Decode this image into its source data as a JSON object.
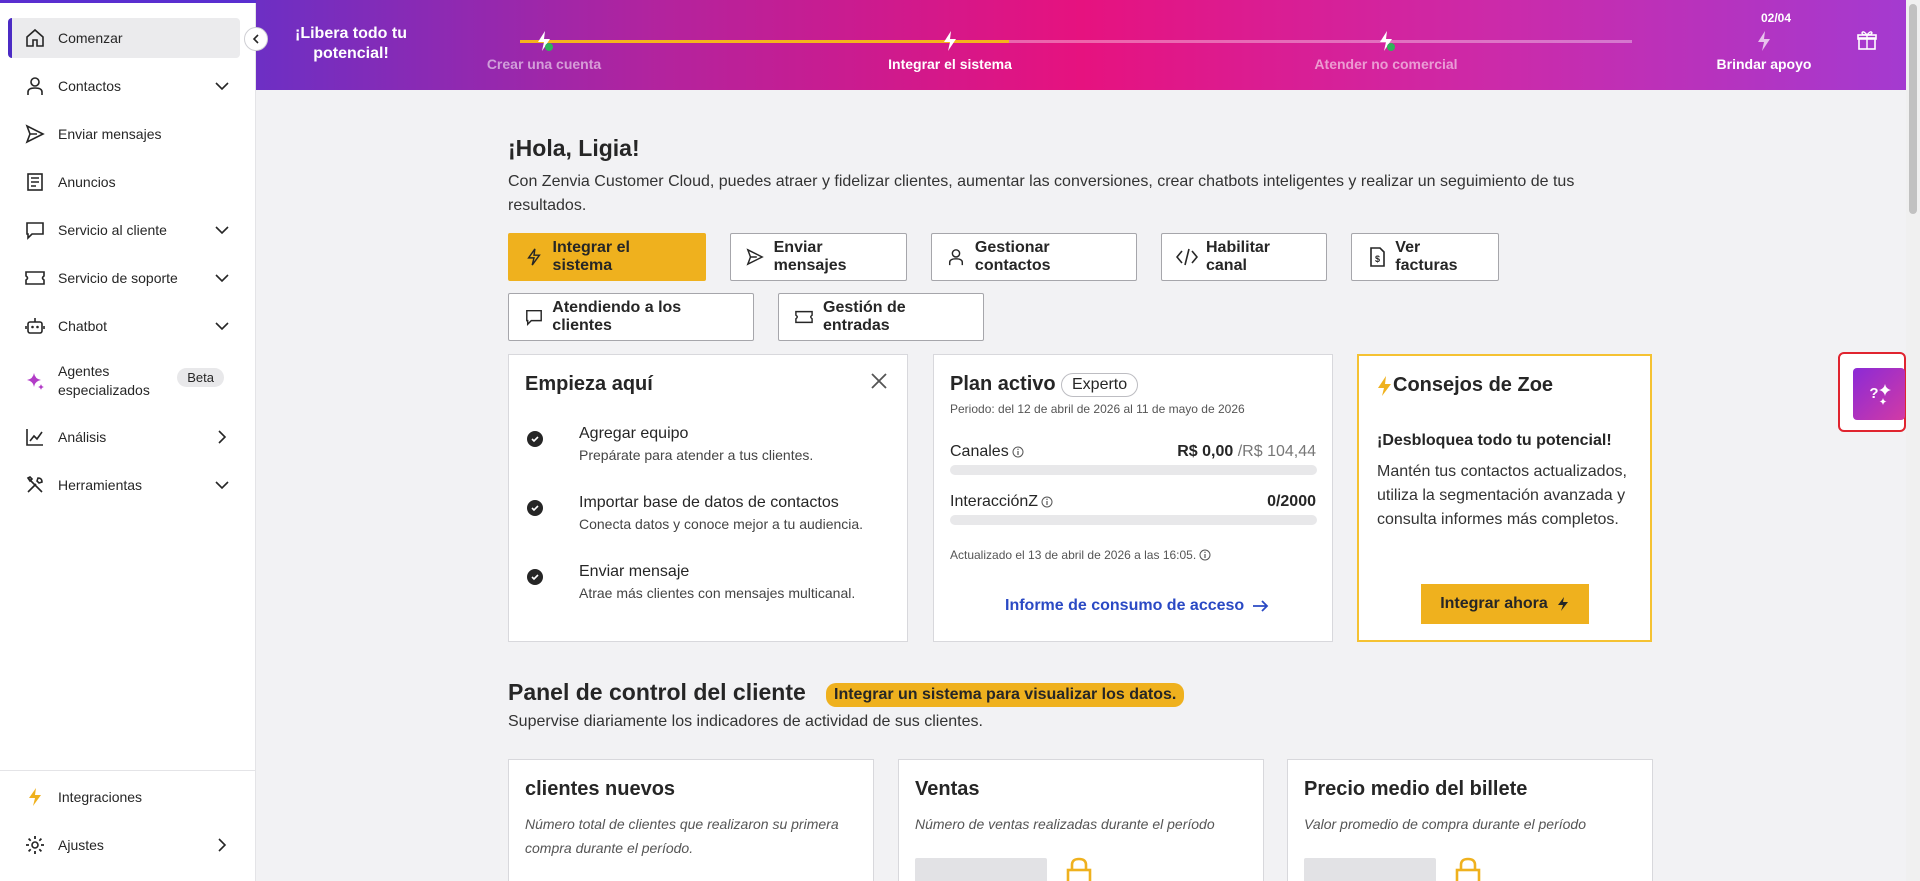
{
  "sidebar": {
    "items": [
      {
        "label": "Comenzar",
        "icon": "home-icon",
        "active": true
      },
      {
        "label": "Contactos",
        "icon": "person-icon"
      },
      {
        "label": "Enviar mensajes",
        "icon": "send-icon"
      },
      {
        "label": "Anuncios",
        "icon": "document-icon"
      },
      {
        "label": "Servicio al cliente",
        "icon": "chat-icon"
      },
      {
        "label": "Servicio de soporte",
        "icon": "ticket-icon"
      },
      {
        "label": "Chatbot",
        "icon": "robot-icon"
      },
      {
        "label": "Agentes especializados",
        "icon": "sparkle-icon",
        "badge": "Beta"
      },
      {
        "label": "Análisis",
        "icon": "chart-icon"
      },
      {
        "label": "Herramientas",
        "icon": "tools-icon"
      }
    ],
    "bottom": [
      {
        "label": "Integraciones",
        "icon": "lightning-icon"
      },
      {
        "label": "Ajustes",
        "icon": "gear-icon"
      }
    ]
  },
  "banner": {
    "title": "¡Libera todo tu potencial!",
    "counter": "02/04",
    "progress": 0.44,
    "steps": [
      {
        "label": "Crear una cuenta",
        "done": true
      },
      {
        "label": "Integrar el sistema",
        "current": true
      },
      {
        "label": "Atender no comercial",
        "done": true
      },
      {
        "label": "Brindar apoyo"
      }
    ]
  },
  "main": {
    "greeting": "¡Hola, Ligia!",
    "intro": "Con Zenvia Customer Cloud, puedes atraer y fidelizar clientes, aumentar las conversiones, crear chatbots inteligentes y realizar un seguimiento de tus resultados.",
    "quick_actions": [
      {
        "label": "Integrar el sistema",
        "icon": "lightning-icon"
      },
      {
        "label": "Enviar mensajes",
        "icon": "send-icon"
      },
      {
        "label": "Gestionar contactos",
        "icon": "person-icon"
      },
      {
        "label": "Habilitar canal",
        "icon": "code-icon"
      },
      {
        "label": "Ver facturas",
        "icon": "invoice-icon"
      },
      {
        "label": "Atendiendo a los clientes",
        "icon": "chat-icon"
      },
      {
        "label": "Gestión de entradas",
        "icon": "ticket-icon"
      }
    ]
  },
  "start_card": {
    "title": "Empieza aquí",
    "tasks": [
      {
        "title": "Agregar equipo",
        "subtitle": "Prepárate para atender a tus clientes."
      },
      {
        "title": "Importar base de datos de contactos",
        "subtitle": "Conecta datos y conoce mejor a tu audiencia."
      },
      {
        "title": "Enviar mensaje",
        "subtitle": "Atrae más clientes con mensajes multicanal."
      }
    ]
  },
  "plan_card": {
    "title": "Plan activo",
    "badge": "Experto",
    "period": "Periodo: del 12 de abril de 2026 al 11 de mayo de 2026",
    "canales_label": "Canales",
    "canales_value": "R$ 0,00",
    "canales_max": "/R$ 104,44",
    "canales_fill": 0,
    "interaccion_label": "InteracciónZ",
    "interaccion_value": "0/2000",
    "interaccion_fill": 0,
    "updated": "Actualizado el 13 de abril de 2026 a las 16:05.",
    "link": "Informe de consumo de acceso"
  },
  "zoe_card": {
    "title": "Consejos de Zoe",
    "subtitle": "¡Desbloquea todo tu potencial!",
    "text": "Mantén tus contactos actualizados, utiliza la segmentación avanzada y consulta informes más completos.",
    "button": "Integrar ahora"
  },
  "panel": {
    "title": "Panel de control del cliente",
    "badge": "Integrar un sistema para visualizar los datos.",
    "subtitle": "Supervise diariamente los indicadores de actividad de sus clientes.",
    "cards": [
      {
        "title": "clientes nuevos",
        "desc": "Número total de clientes que realizaron su primera compra durante el período."
      },
      {
        "title": "Ventas",
        "desc": "Número de ventas realizadas durante el período"
      },
      {
        "title": "Precio medio del billete",
        "desc": "Valor promedio de compra durante el período"
      }
    ]
  },
  "colors": {
    "accent": "#efb11e",
    "brand": "#4b2bc4",
    "link": "#2a49c4"
  }
}
